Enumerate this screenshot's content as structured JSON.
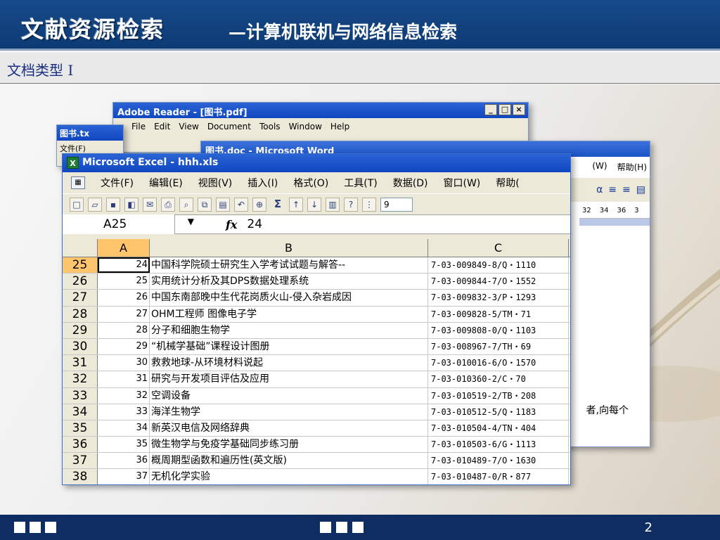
{
  "slide": {
    "logo_title": "文献资源检索",
    "subtitle": "—计算机联机与网络信息检索",
    "section_title": "文档类型 I",
    "page_number": "2"
  },
  "adobe": {
    "title": "Adobe Reader - [图书.pdf]",
    "menu": [
      "File",
      "Edit",
      "View",
      "Document",
      "Tools",
      "Window",
      "Help"
    ]
  },
  "notepad": {
    "title": "图书.tx",
    "menu": "文件(F)"
  },
  "word": {
    "title": "图书.doc - Microsoft Word",
    "menu": [
      "(W)",
      "帮助(H)"
    ],
    "ruler": [
      "32",
      "34",
      "36",
      "3"
    ],
    "text": "者,向每个"
  },
  "excel": {
    "title": "Microsoft Excel - hhh.xls",
    "menu": [
      "文件(F)",
      "编辑(E)",
      "视图(V)",
      "插入(I)",
      "格式(O)",
      "工具(T)",
      "数据(D)",
      "窗口(W)",
      "帮助("
    ],
    "font_size": "9",
    "name_box": "A25",
    "formula_value": "24",
    "columns": [
      "A",
      "B",
      "C"
    ],
    "rows": [
      {
        "num": "25",
        "a": "24",
        "b": "中国科学院硕士研究生入学考试试题与解答--",
        "c": "7-03-009849-8/Q・1110"
      },
      {
        "num": "26",
        "a": "25",
        "b": "实用统计分析及其DPS数据处理系统",
        "c": "7-03-009844-7/O・1552"
      },
      {
        "num": "27",
        "a": "26",
        "b": "中国东南部晚中生代花岗质火山-侵入杂岩成因",
        "c": "7-03-009832-3/P・1293"
      },
      {
        "num": "28",
        "a": "27",
        "b": "OHM工程师 图像电子学",
        "c": "7-03-009828-5/TM・71"
      },
      {
        "num": "29",
        "a": "28",
        "b": "分子和细胞生物学",
        "c": "7-03-009808-0/Q・1103"
      },
      {
        "num": "30",
        "a": "29",
        "b": "“机械学基础”课程设计图册",
        "c": "7-03-008967-7/TH・69"
      },
      {
        "num": "31",
        "a": "30",
        "b": "救救地球-从环境材料说起",
        "c": "7-03-010016-6/O・1570"
      },
      {
        "num": "32",
        "a": "31",
        "b": "研究与开发项目评估及应用",
        "c": "7-03-010360-2/C・70"
      },
      {
        "num": "33",
        "a": "32",
        "b": "空调设备",
        "c": "7-03-010519-2/TB・208"
      },
      {
        "num": "34",
        "a": "33",
        "b": "海洋生物学",
        "c": "7-03-010512-5/Q・1183"
      },
      {
        "num": "35",
        "a": "34",
        "b": "新英汉电信及网络辞典",
        "c": "7-03-010504-4/TN・404"
      },
      {
        "num": "36",
        "a": "35",
        "b": "微生物学与免疫学基础同步练习册",
        "c": "7-03-010503-6/G・1113"
      },
      {
        "num": "37",
        "a": "36",
        "b": "概周期型函数和遍历性(英文版)",
        "c": "7-03-010489-7/O・1630"
      },
      {
        "num": "38",
        "a": "37",
        "b": "无机化学实验",
        "c": "7-03-010487-0/R・877"
      }
    ]
  },
  "colors": {
    "header_blue": "#0d3a74",
    "footer_blue": "#0d2d63",
    "xp_title": "#0f47c2",
    "active_header": "#ffc56d"
  }
}
